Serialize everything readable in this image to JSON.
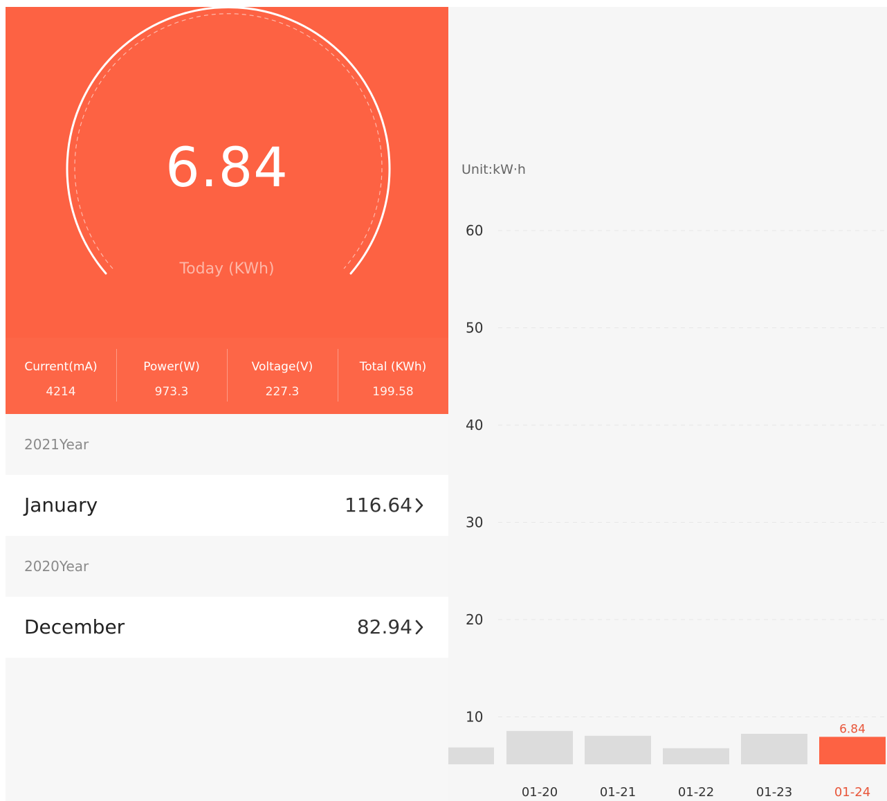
{
  "summary": {
    "today_value": "6.84",
    "today_label": "Today (KWh)",
    "stats": [
      {
        "label": "Current(mA)",
        "value": "4214"
      },
      {
        "label": "Power(W)",
        "value": "973.3"
      },
      {
        "label": "Voltage(V)",
        "value": "227.3"
      },
      {
        "label": "Total (KWh)",
        "value": "199.58"
      }
    ]
  },
  "history": [
    {
      "year_label": "2021Year",
      "month": "January",
      "value": "116.64"
    },
    {
      "year_label": "2020Year",
      "month": "December",
      "value": "82.94"
    }
  ],
  "icons": {
    "row_chevron": "chevron-right-icon"
  },
  "colors": {
    "accent": "#fd6243",
    "bar": "#dcdcdc",
    "highlight_text": "#e8563a"
  },
  "chart_data": {
    "type": "bar",
    "unit_label": "Unit:kW·h",
    "y_ticks": [
      "60",
      "50",
      "40",
      "30",
      "20",
      "10"
    ],
    "ylim": [
      0,
      60
    ],
    "categories": [
      "",
      "01-20",
      "01-21",
      "01-22",
      "01-23",
      "01-24"
    ],
    "values": [
      4.2,
      8.3,
      7.1,
      4.0,
      7.6,
      6.84
    ],
    "highlight_index": 5,
    "highlight_label": "6.84",
    "grid": true
  }
}
